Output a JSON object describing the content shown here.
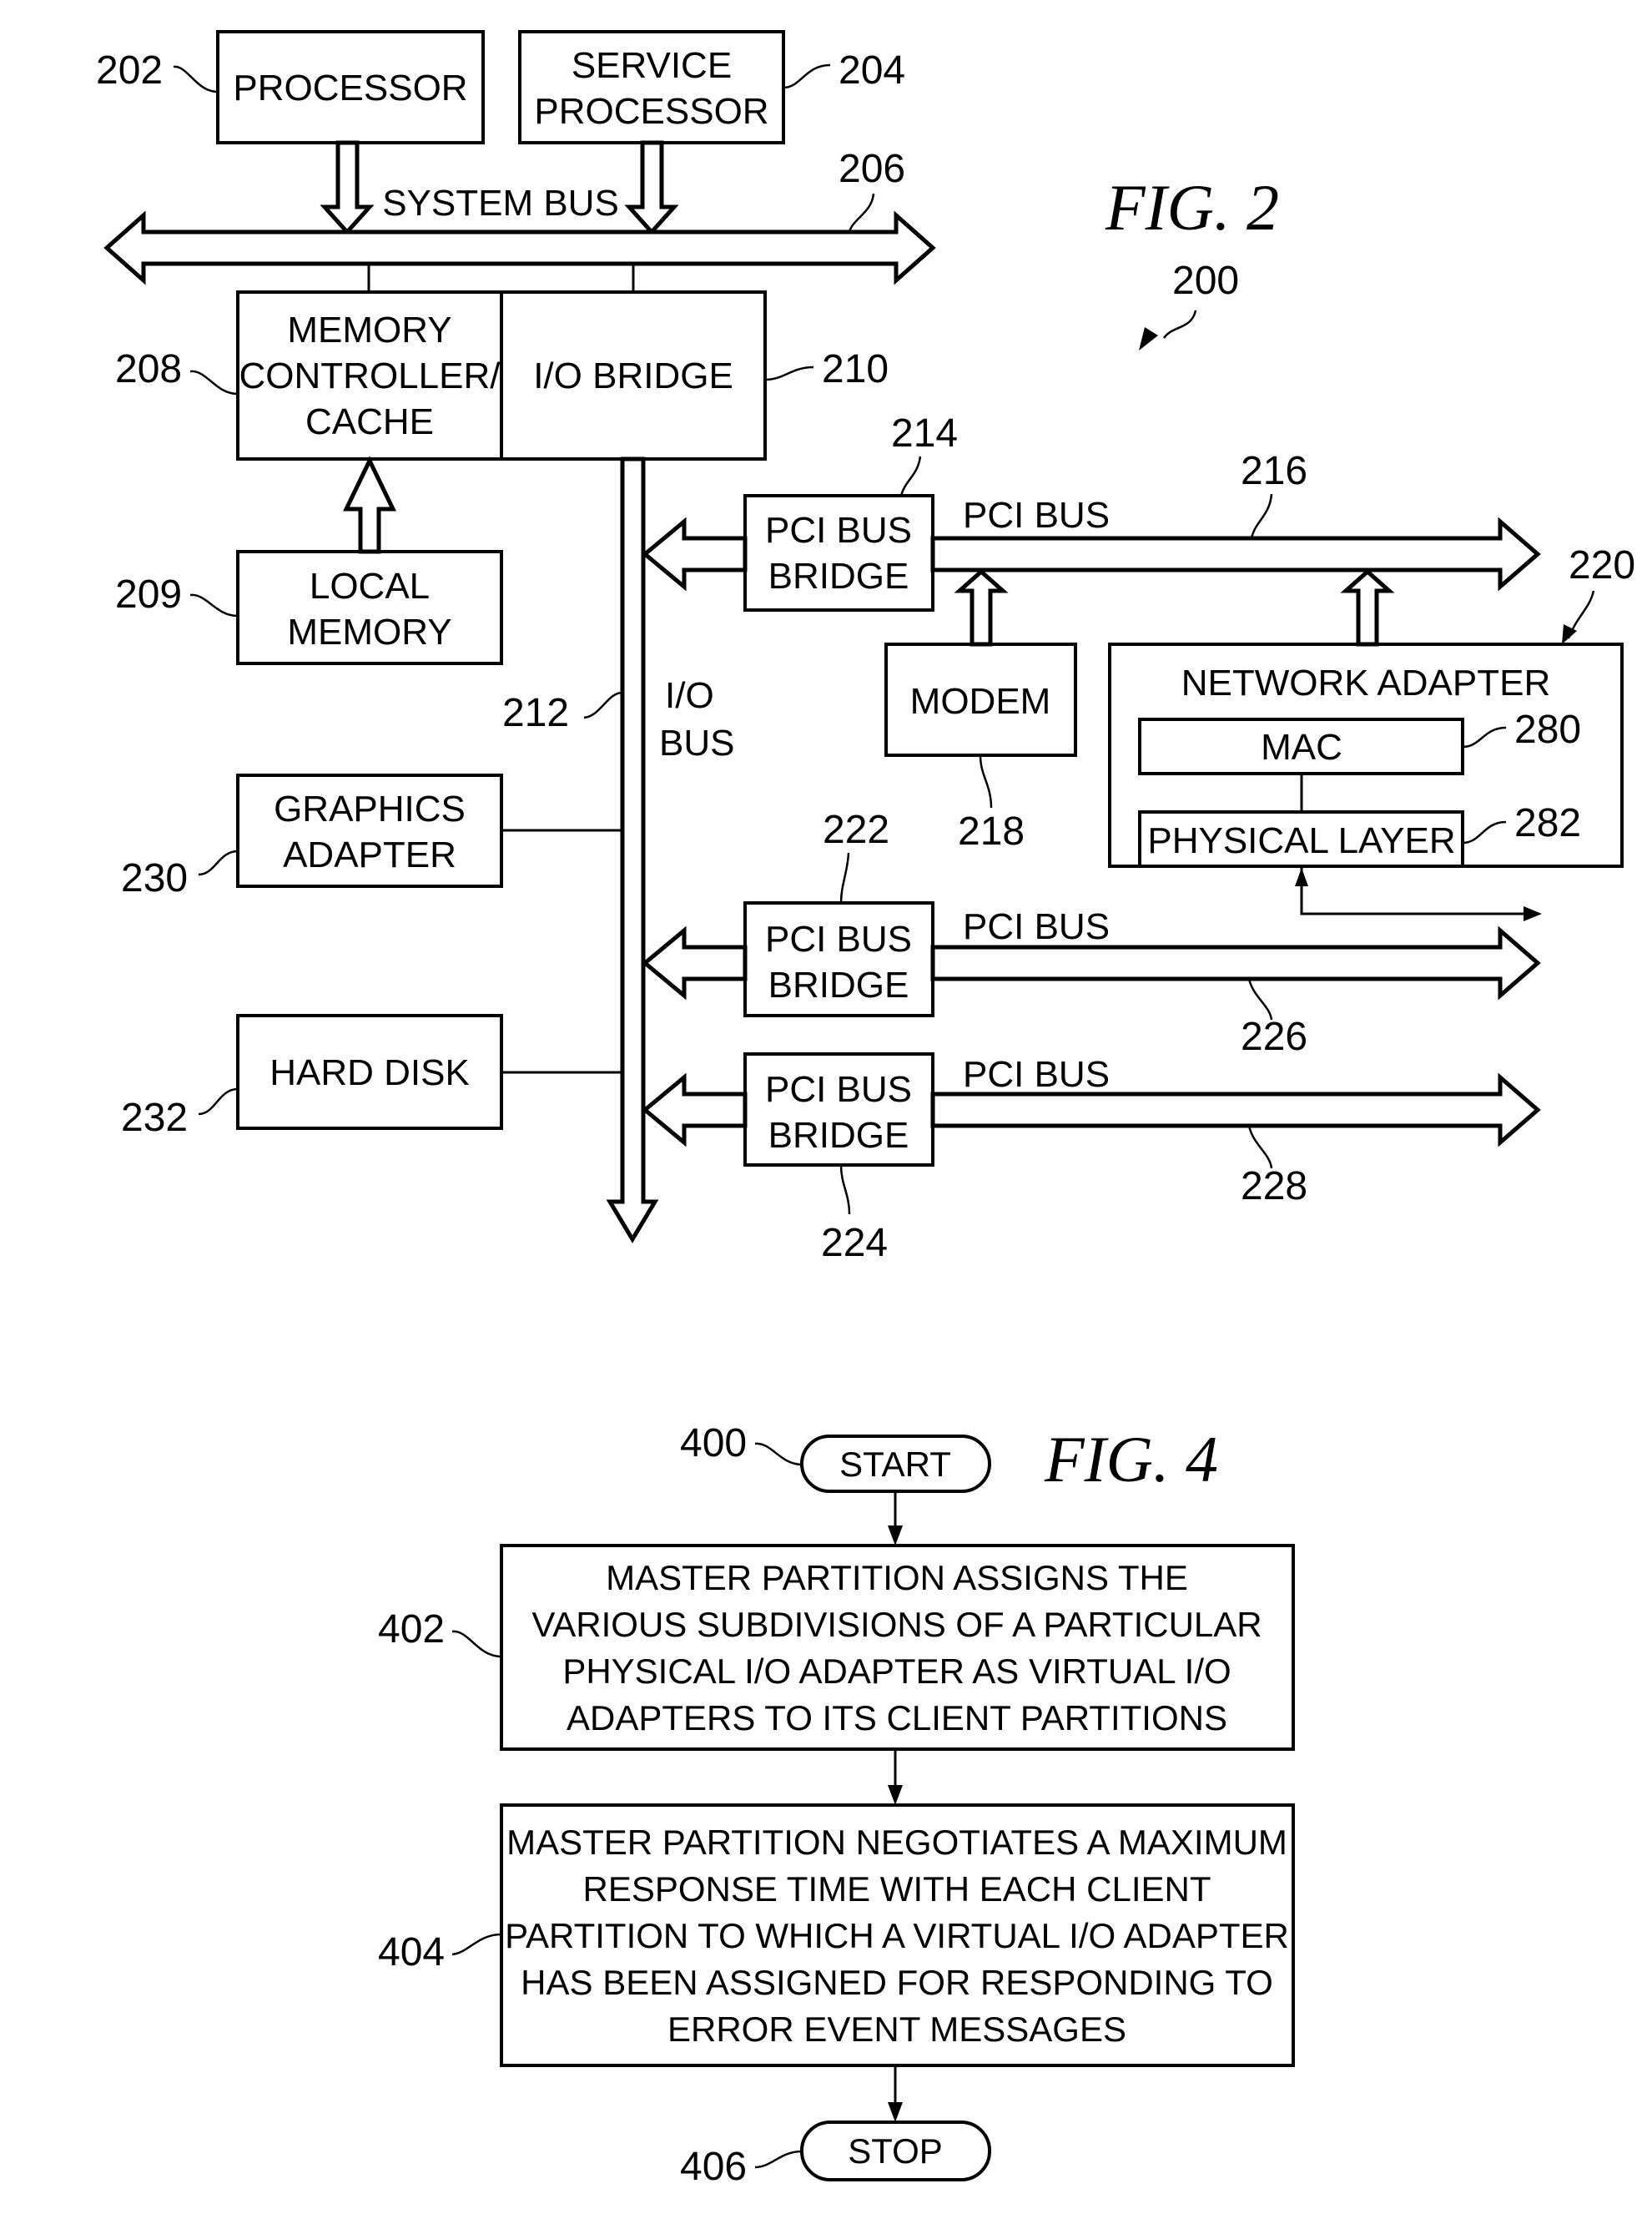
{
  "fig2": {
    "title": "FIG. 2",
    "ref": "200",
    "processor": {
      "label": "PROCESSOR",
      "ref": "202"
    },
    "service_processor": {
      "label_lines": [
        "SERVICE",
        "PROCESSOR"
      ],
      "ref": "204"
    },
    "system_bus": {
      "label": "SYSTEM BUS",
      "ref": "206"
    },
    "memory_controller": {
      "label_lines": [
        "MEMORY",
        "CONTROLLER/",
        "CACHE"
      ],
      "ref": "208"
    },
    "local_memory": {
      "label_lines": [
        "LOCAL",
        "MEMORY"
      ],
      "ref": "209"
    },
    "io_bridge": {
      "label": "I/O BRIDGE",
      "ref": "210"
    },
    "io_bus": {
      "label_lines": [
        "I/O",
        "BUS"
      ],
      "ref": "212"
    },
    "pci_bridge_1": {
      "label_lines": [
        "PCI BUS",
        "BRIDGE"
      ],
      "ref": "214"
    },
    "pci_bus_1": {
      "label": "PCI BUS",
      "ref": "216"
    },
    "modem": {
      "label": "MODEM",
      "ref": "218"
    },
    "network_adapter": {
      "label": "NETWORK ADAPTER",
      "ref": "220"
    },
    "mac": {
      "label": "MAC",
      "ref": "280"
    },
    "physical_layer": {
      "label": "PHYSICAL LAYER",
      "ref": "282"
    },
    "pci_bridge_2": {
      "label_lines": [
        "PCI BUS",
        "BRIDGE"
      ],
      "ref": "222"
    },
    "pci_bus_2": {
      "label": "PCI BUS",
      "ref": "226"
    },
    "pci_bridge_3": {
      "label_lines": [
        "PCI BUS",
        "BRIDGE"
      ],
      "ref": "224"
    },
    "pci_bus_3": {
      "label": "PCI BUS",
      "ref": "228"
    },
    "graphics_adapter": {
      "label_lines": [
        "GRAPHICS",
        "ADAPTER"
      ],
      "ref": "230"
    },
    "hard_disk": {
      "label": "HARD DISK",
      "ref": "232"
    }
  },
  "fig4": {
    "title": "FIG. 4",
    "start": {
      "label": "START",
      "ref": "400"
    },
    "step402": {
      "ref": "402",
      "lines": [
        "MASTER PARTITION ASSIGNS THE",
        "VARIOUS SUBDIVISIONS OF A PARTICULAR",
        "PHYSICAL I/O ADAPTER AS VIRTUAL I/O",
        "ADAPTERS TO ITS CLIENT PARTITIONS"
      ]
    },
    "step404": {
      "ref": "404",
      "lines": [
        "MASTER PARTITION NEGOTIATES A MAXIMUM",
        "RESPONSE TIME WITH EACH CLIENT",
        "PARTITION TO WHICH A VIRTUAL I/O ADAPTER",
        "HAS BEEN ASSIGNED FOR RESPONDING TO",
        "ERROR EVENT MESSAGES"
      ]
    },
    "stop": {
      "label": "STOP",
      "ref": "406"
    }
  }
}
